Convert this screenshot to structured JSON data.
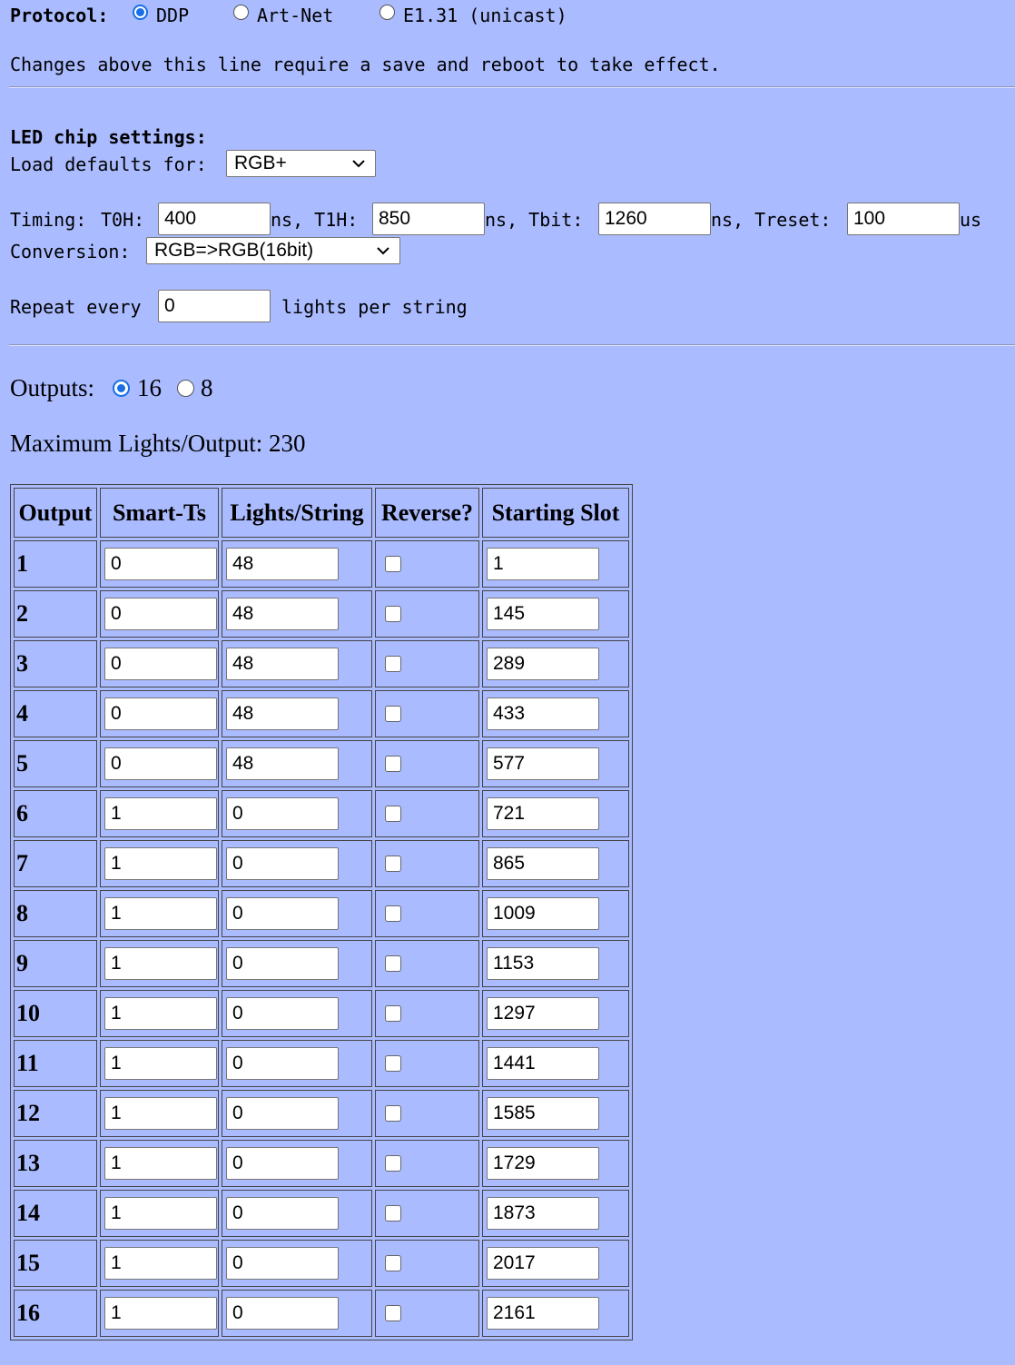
{
  "protocol": {
    "label": "Protocol:",
    "options": [
      {
        "label": "DDP",
        "checked": true
      },
      {
        "label": "Art-Net",
        "checked": false
      },
      {
        "label": "E1.31 (unicast)",
        "checked": false
      }
    ]
  },
  "notice": "Changes above this line require a save and reboot to take effect.",
  "chip": {
    "heading": "LED chip settings:",
    "defaults_label": "Load defaults for:",
    "defaults_value": "RGB+"
  },
  "timing": {
    "label": "Timing:",
    "t0h_label": "T0H:",
    "t0h": "400",
    "t1h_label": "ns, T1H:",
    "t1h": "850",
    "tbit_label": "ns, Tbit:",
    "tbit": "1260",
    "treset_label": "ns, Treset:",
    "treset": "100",
    "treset_unit": "us"
  },
  "conversion": {
    "label": "Conversion:",
    "value": "RGB=>RGB(16bit)"
  },
  "repeat": {
    "label": "Repeat every",
    "value": "0",
    "suffix": "lights per string"
  },
  "outputs": {
    "label": "Outputs:",
    "options": [
      {
        "label": "16",
        "checked": true
      },
      {
        "label": "8",
        "checked": false
      }
    ]
  },
  "max_lights": "Maximum Lights/Output: 230",
  "table": {
    "headers": [
      "Output",
      "Smart-Ts",
      "Lights/String",
      "Reverse?",
      "Starting Slot"
    ],
    "rows": [
      {
        "output": "1",
        "smart": "0",
        "lights": "48",
        "reverse": false,
        "slot": "1"
      },
      {
        "output": "2",
        "smart": "0",
        "lights": "48",
        "reverse": false,
        "slot": "145"
      },
      {
        "output": "3",
        "smart": "0",
        "lights": "48",
        "reverse": false,
        "slot": "289"
      },
      {
        "output": "4",
        "smart": "0",
        "lights": "48",
        "reverse": false,
        "slot": "433"
      },
      {
        "output": "5",
        "smart": "0",
        "lights": "48",
        "reverse": false,
        "slot": "577"
      },
      {
        "output": "6",
        "smart": "1",
        "lights": "0",
        "reverse": false,
        "slot": "721"
      },
      {
        "output": "7",
        "smart": "1",
        "lights": "0",
        "reverse": false,
        "slot": "865"
      },
      {
        "output": "8",
        "smart": "1",
        "lights": "0",
        "reverse": false,
        "slot": "1009"
      },
      {
        "output": "9",
        "smart": "1",
        "lights": "0",
        "reverse": false,
        "slot": "1153"
      },
      {
        "output": "10",
        "smart": "1",
        "lights": "0",
        "reverse": false,
        "slot": "1297"
      },
      {
        "output": "11",
        "smart": "1",
        "lights": "0",
        "reverse": false,
        "slot": "1441"
      },
      {
        "output": "12",
        "smart": "1",
        "lights": "0",
        "reverse": false,
        "slot": "1585"
      },
      {
        "output": "13",
        "smart": "1",
        "lights": "0",
        "reverse": false,
        "slot": "1729"
      },
      {
        "output": "14",
        "smart": "1",
        "lights": "0",
        "reverse": false,
        "slot": "1873"
      },
      {
        "output": "15",
        "smart": "1",
        "lights": "0",
        "reverse": false,
        "slot": "2017"
      },
      {
        "output": "16",
        "smart": "1",
        "lights": "0",
        "reverse": false,
        "slot": "2161"
      }
    ]
  }
}
